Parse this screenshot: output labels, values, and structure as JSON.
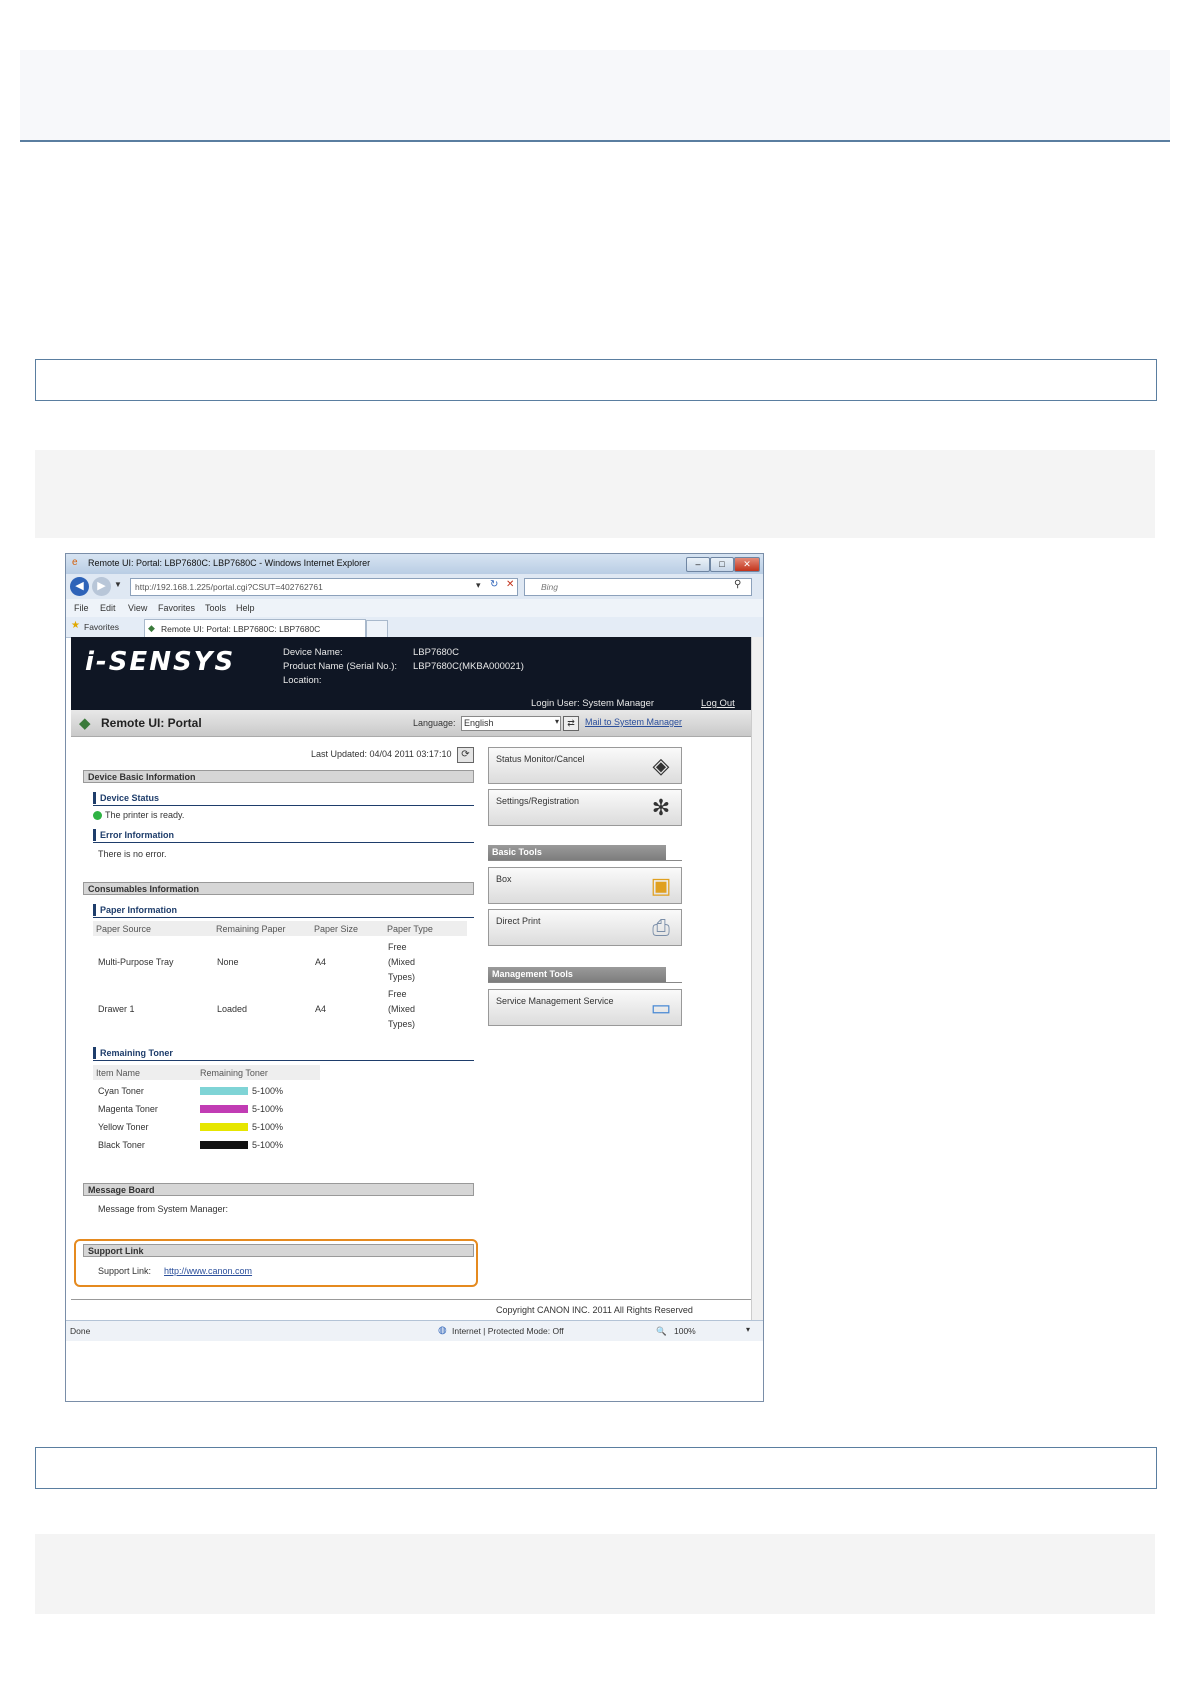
{
  "browser": {
    "title": "Remote UI: Portal: LBP7680C: LBP7680C - Windows Internet Explorer",
    "address": "http://192.168.1.225/portal.cgi?CSUT=402762761",
    "search_placeholder": "Bing",
    "menu": [
      "File",
      "Edit",
      "View",
      "Favorites",
      "Tools",
      "Help"
    ],
    "favorites_label": "Favorites",
    "tab_label": "Remote UI: Portal: LBP7680C: LBP7680C",
    "status_left": "Done",
    "status_zone": "Internet | Protected Mode: Off",
    "zoom": "100%"
  },
  "banner": {
    "logo": "i-SENSYS",
    "device_name_label": "Device Name:",
    "device_name": "LBP7680C",
    "product_name_label": "Product Name (Serial No.):",
    "product_name": "LBP7680C(MKBA000021)",
    "location_label": "Location:",
    "login": "Login User: System Manager",
    "logout": "Log Out"
  },
  "portal": {
    "title": "Remote UI: Portal",
    "language_label": "Language:",
    "language_value": "English",
    "mail_link": "Mail to System Manager",
    "last_updated": "Last Updated: 04/04 2011 03:17:10"
  },
  "device_basic": {
    "heading": "Device Basic Information",
    "status_heading": "Device Status",
    "status_text": "The printer is ready.",
    "error_heading": "Error Information",
    "error_text": "There is no error."
  },
  "consumables": {
    "heading": "Consumables Information",
    "paper_heading": "Paper Information",
    "paper_columns": [
      "Paper Source",
      "Remaining Paper",
      "Paper Size",
      "Paper Type"
    ],
    "paper_rows": [
      {
        "source": "Multi-Purpose Tray",
        "remaining": "None",
        "size": "A4",
        "type1": "Free",
        "type2": "(Mixed",
        "type3": "Types)"
      },
      {
        "source": "Drawer 1",
        "remaining": "Loaded",
        "size": "A4",
        "type1": "Free",
        "type2": "(Mixed",
        "type3": "Types)"
      }
    ],
    "toner_heading": "Remaining Toner",
    "toner_columns": [
      "Item Name",
      "Remaining Toner"
    ],
    "toners": [
      {
        "name": "Cyan Toner",
        "value": "5-100%",
        "color": "#7fd4d6"
      },
      {
        "name": "Magenta Toner",
        "value": "5-100%",
        "color": "#c13cb4"
      },
      {
        "name": "Yellow Toner",
        "value": "5-100%",
        "color": "#e6e600"
      },
      {
        "name": "Black Toner",
        "value": "5-100%",
        "color": "#111111"
      }
    ]
  },
  "message_board": {
    "heading": "Message Board",
    "text": "Message from System Manager:"
  },
  "support": {
    "heading": "Support Link",
    "label": "Support Link:",
    "url": "http://www.canon.com"
  },
  "right_panel": {
    "status_monitor": "Status Monitor/Cancel",
    "settings": "Settings/Registration",
    "basic_tools": "Basic Tools",
    "box": "Box",
    "direct_print": "Direct Print",
    "management_tools": "Management Tools",
    "service_mgmt": "Service Management Service"
  },
  "copyright": "Copyright CANON INC. 2011 All Rights Reserved",
  "colors": {
    "accent_border": "#5a7ea0",
    "highlight": "#e58a1f",
    "banner_bg": "#0f1624",
    "status_ok": "#2fb344"
  }
}
